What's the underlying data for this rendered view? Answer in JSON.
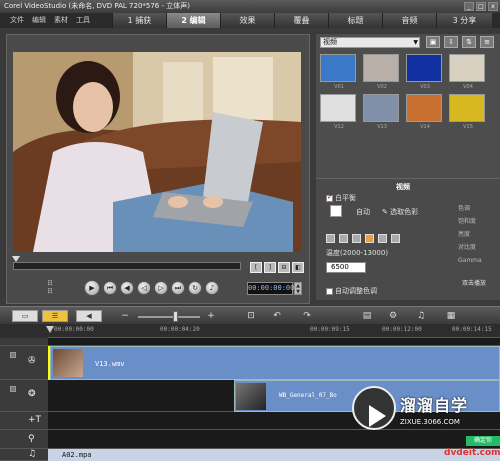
{
  "window": {
    "title": "Corel VideoStudio (未命名, DVD PAL 720*576 - 立体声)",
    "minimize": "_",
    "maximize": "□",
    "close": "x"
  },
  "menu": [
    "文件",
    "编辑",
    "素材",
    "工具"
  ],
  "steps": [
    {
      "label": "1 捕获",
      "active": false
    },
    {
      "label": "2 编辑",
      "active": true
    },
    {
      "label": "效果",
      "active": false
    },
    {
      "label": "覆叠",
      "active": false
    },
    {
      "label": "标题",
      "active": false
    },
    {
      "label": "音频",
      "active": false
    },
    {
      "label": "3 分享",
      "active": false
    }
  ],
  "preview": {
    "timecode": "00:00:00:00",
    "mini_labels": [
      "日",
      "日"
    ],
    "trim_buttons": [
      "[",
      "]",
      "⊟",
      "◧"
    ],
    "transport": [
      {
        "name": "play-button",
        "glyph": "▶"
      },
      {
        "name": "home-button",
        "glyph": "⏮"
      },
      {
        "name": "prev-frame-button",
        "glyph": "◀"
      },
      {
        "name": "rewind-button",
        "glyph": "◁"
      },
      {
        "name": "forward-button",
        "glyph": "▷"
      },
      {
        "name": "end-button",
        "glyph": "⏭"
      },
      {
        "name": "repeat-button",
        "glyph": "↻"
      },
      {
        "name": "volume-button",
        "glyph": "♪"
      }
    ]
  },
  "library": {
    "category": "视频",
    "thumbs": [
      {
        "label": "V01",
        "color": "#3a78c8"
      },
      {
        "label": "V02",
        "color": "#b8b0a8"
      },
      {
        "label": "V03",
        "color": "#1030a0"
      },
      {
        "label": "V04",
        "color": "#d8d0c0"
      },
      {
        "label": "V12",
        "color": "#e0e0e0"
      },
      {
        "label": "V13",
        "color": "#8090a8"
      },
      {
        "label": "V14",
        "color": "#c87030"
      },
      {
        "label": "V15",
        "color": "#d8b820"
      }
    ]
  },
  "options": {
    "title": "视频",
    "white_balance": "白平衡",
    "auto": "自动",
    "pick_color": "选取色彩",
    "temperature_label": "温度(2000-13000)",
    "temperature_value": "6500",
    "auto_tone": "自动调整色调",
    "right_labels": [
      "色调",
      "饱和度",
      "亮度",
      "对比度",
      "Gamma"
    ],
    "keep_wide": "双击播放"
  },
  "timeline": {
    "ruler_ticks": [
      "00:00:00:00",
      "00:00:04:20",
      "00:00:09:15",
      "00:00:12:00",
      "00:00:14:15"
    ],
    "video_clip": "V13.wmv",
    "overlay_clip": "WB_General_07_Bo",
    "audio_clip": "A02.mpa"
  },
  "watermark": {
    "brand": "溜溜自学",
    "site": "ZIXUE.3066.COM",
    "badge": "确定你",
    "corner": "dvdeit.com"
  }
}
